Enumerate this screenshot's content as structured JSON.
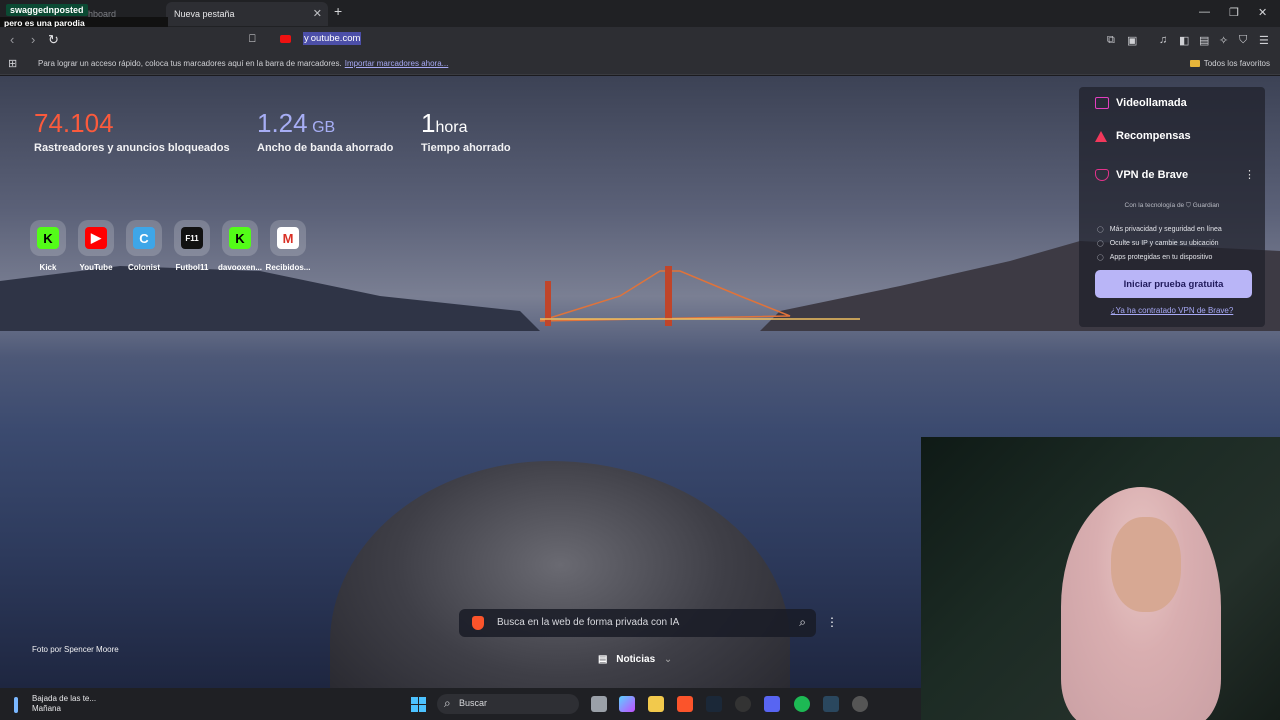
{
  "overlay": {
    "badge": "swaggednposted",
    "subtitle": "pero es una parodia"
  },
  "tabs": [
    {
      "label": "hboard"
    },
    {
      "label": "Nueva pestaña"
    }
  ],
  "address_bar": {
    "url_selected": "y",
    "url_rest": "outube.com"
  },
  "bookmarks_bar": {
    "hint": "Para lograr un acceso rápido, coloca tus marcadores aquí en la barra de marcadores.",
    "import_link": "Importar marcadores ahora...",
    "all_favorites": "Todos los favoritos"
  },
  "stats": [
    {
      "value": "74.104",
      "unit": "",
      "label": "Rastreadores y anuncios bloqueados",
      "color": "#fb5a3c"
    },
    {
      "value": "1.24",
      "unit": "GB",
      "label": "Ancho de banda ahorrado",
      "color": "#a7aef5"
    },
    {
      "value": "1",
      "unit": "hora",
      "label": "Tiempo ahorrado",
      "color": "#ffffff"
    }
  ],
  "top_sites": [
    {
      "name": "Kick",
      "glyph": "K",
      "bg": "#53fc18",
      "fg": "#000000"
    },
    {
      "name": "YouTube",
      "glyph": "▶",
      "bg": "#ff0000",
      "fg": "#ffffff"
    },
    {
      "name": "Colonist",
      "glyph": "C",
      "bg": "#3ea6e8",
      "fg": "#ffffff"
    },
    {
      "name": "Futbol11",
      "glyph": "F11",
      "bg": "#111111",
      "fg": "#ffffff"
    },
    {
      "name": "davooxen...",
      "glyph": "K",
      "bg": "#53fc18",
      "fg": "#000000"
    },
    {
      "name": "Recibidos...",
      "glyph": "M",
      "bg": "#ffffff",
      "fg": "#d93025"
    }
  ],
  "promo_panel": {
    "videocall": "Videollamada",
    "rewards": "Recompensas",
    "vpn_title": "VPN de Brave",
    "powered_by": "Con la tecnología de",
    "guardian": "Guardian",
    "bullets": [
      "Más privacidad y seguridad en línea",
      "Oculte su IP y cambie su ubicación",
      "Apps protegidas en tu dispositivo"
    ],
    "cta": "Iniciar prueba gratuita",
    "link": "¿Ya ha contratado VPN de Brave?"
  },
  "photo_credit": "Foto por Spencer Moore",
  "search": {
    "placeholder": "Busca en la web de forma privada con IA"
  },
  "news": {
    "label": "Noticias"
  },
  "taskbar": {
    "weather_title": "Bajada de las te...",
    "weather_sub": "Mañana",
    "search_label": "Buscar"
  }
}
